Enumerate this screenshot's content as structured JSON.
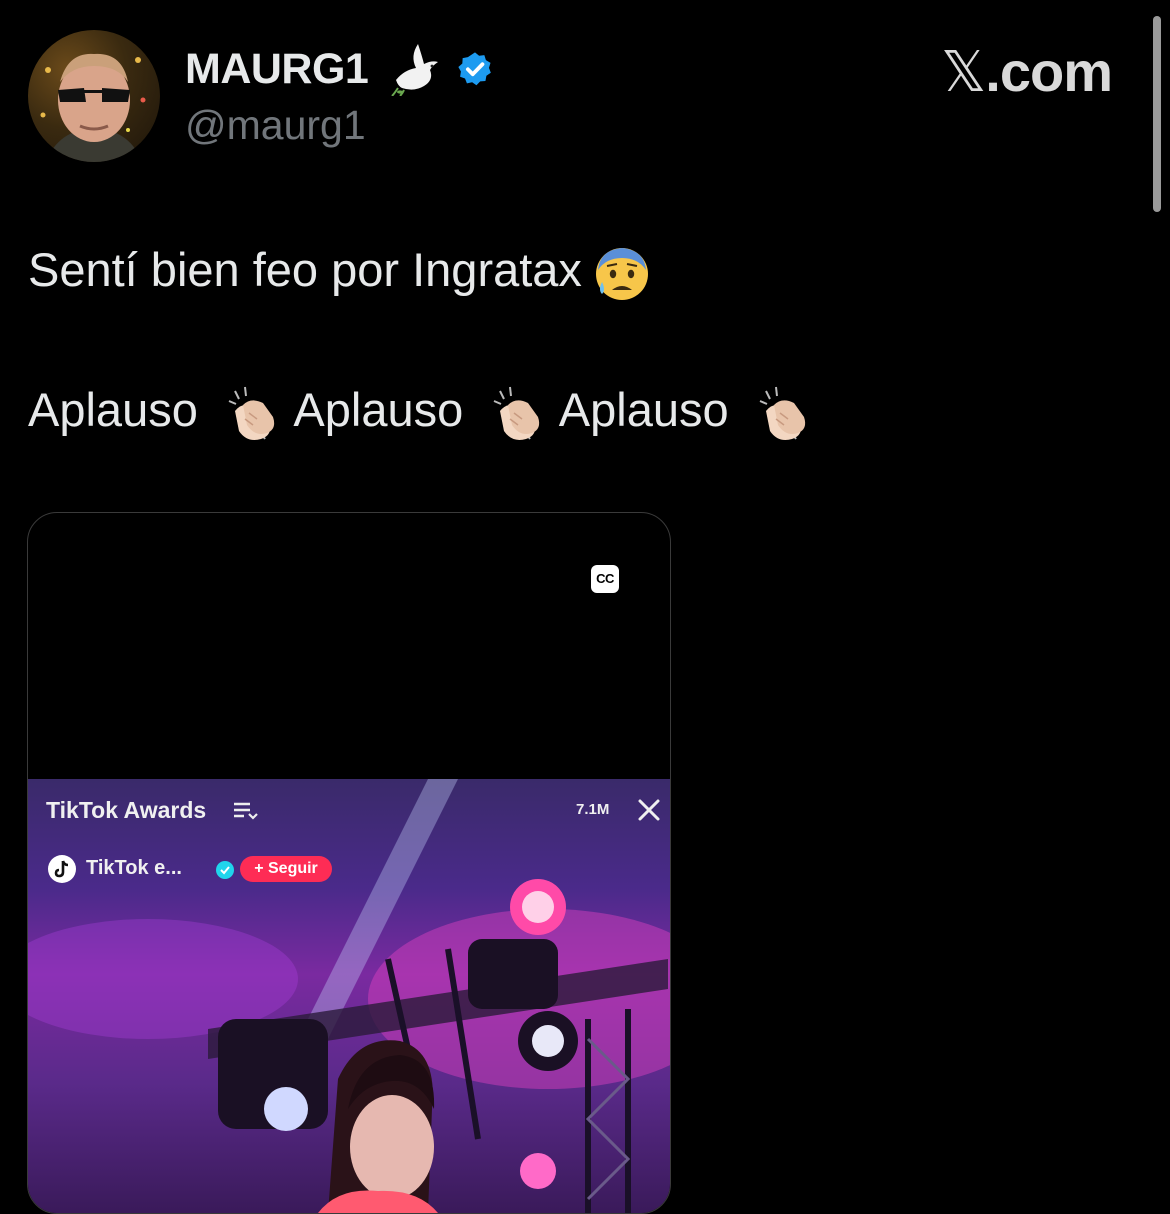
{
  "author": {
    "display_name": "MAURG1",
    "handle": "@maurg1",
    "dove_icon": "dove-emoji",
    "verified_icon": "verified-badge",
    "verified_color": "#1d9bf0"
  },
  "brand": {
    "glyph": "𝕏",
    "suffix": ".com"
  },
  "tweet": {
    "line1_text": "Sentí bien feo por Ingratax",
    "line1_emoji": "anxious-sweat-face",
    "line2_words": [
      "Aplauso",
      "Aplauso",
      "Aplauso"
    ],
    "line2_emoji": "clapping-hands"
  },
  "media": {
    "cc_label": "CC",
    "video_overlay": {
      "title": "TikTok Awards",
      "views": "7.1M",
      "account_name": "TikTok e...",
      "follow_label": "+ Seguir",
      "follow_color": "#fe2c55"
    }
  },
  "colors": {
    "background": "#000000",
    "primary_text": "#e7e9ea",
    "secondary_text": "#71767b"
  }
}
